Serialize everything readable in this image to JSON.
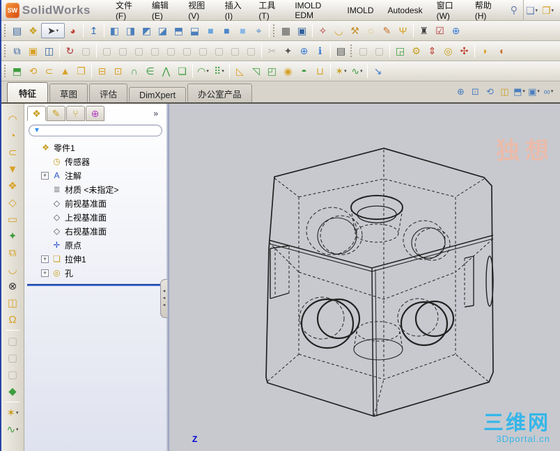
{
  "window": {
    "app_name": "SolidWorks",
    "logo_text": "SW"
  },
  "menu": {
    "items": [
      "文件(F)",
      "编辑(E)",
      "视图(V)",
      "插入(I)",
      "工具(T)",
      "IMOLD EDM",
      "IMOLD",
      "Autodesk",
      "窗口(W)",
      "帮助(H)"
    ],
    "search_glyph": "⚲"
  },
  "quick_access": [
    {
      "n": "new-document-button",
      "g": "❏",
      "c": "#6a82b4",
      "dd": true
    },
    {
      "n": "open-document-button",
      "g": "❐",
      "c": "#d8a228",
      "dd": true
    }
  ],
  "toolbars": {
    "row2": [
      {
        "grip": true
      },
      {
        "n": "properties-icon",
        "g": "▤",
        "c": "#35639f"
      },
      {
        "n": "make-part-icon",
        "g": "❖",
        "c": "#c8a020"
      },
      {
        "n": "select-arrow-icon",
        "g": "➤",
        "c": "#3b3b3b",
        "dd": true,
        "box": true
      },
      {
        "n": "render-sphere-icon",
        "g": "◕",
        "c": "#c04030"
      },
      {
        "sep": true
      },
      {
        "n": "move-entity-icon",
        "g": "↥",
        "c": "#2f6fb4"
      },
      {
        "sep": true
      },
      {
        "n": "view-cube-front-icon",
        "g": "◧",
        "c": "#4a7ebc"
      },
      {
        "n": "view-cube-back-icon",
        "g": "◨",
        "c": "#4a7ebc"
      },
      {
        "n": "view-cube-left-icon",
        "g": "◩",
        "c": "#4a7ebc"
      },
      {
        "n": "view-cube-right-icon",
        "g": "◪",
        "c": "#4a7ebc"
      },
      {
        "n": "view-cube-top-icon",
        "g": "⬒",
        "c": "#4a7ebc"
      },
      {
        "n": "view-cube-bottom-icon",
        "g": "⬓",
        "c": "#4a7ebc"
      },
      {
        "n": "view-iso-icon",
        "g": "■",
        "c": "#6aa5dd"
      },
      {
        "n": "view-trimetric-icon",
        "g": "■",
        "c": "#4a86c8"
      },
      {
        "n": "view-dimetric-icon",
        "g": "■",
        "c": "#86b8e8"
      },
      {
        "n": "flashlight-icon",
        "g": "⌖",
        "c": "#4a86c8"
      },
      {
        "sep": true
      },
      {
        "grip": true
      },
      {
        "n": "print-preview-icon",
        "g": "▦",
        "c": "#555"
      },
      {
        "n": "window-preview-icon",
        "g": "▣",
        "c": "#35639f"
      },
      {
        "sep": true
      },
      {
        "n": "measure-icon",
        "g": "✧",
        "c": "#b03030"
      },
      {
        "n": "mass-properties-icon",
        "g": "◡",
        "c": "#d8a228"
      },
      {
        "n": "check-hammer-icon",
        "g": "⚒",
        "c": "#c8922a"
      },
      {
        "n": "curvature-icon",
        "g": "◌",
        "c": "#d8a228"
      },
      {
        "n": "paint-check-icon",
        "g": "✎",
        "c": "#c8702a"
      },
      {
        "n": "deviation-icon",
        "g": "Ψ",
        "c": "#d8a228"
      },
      {
        "sep": true
      },
      {
        "n": "options-plug-icon",
        "g": "♜",
        "c": "#444"
      },
      {
        "n": "design-checker-icon",
        "g": "☑",
        "c": "#b03030"
      },
      {
        "n": "search-blue-icon",
        "g": "⊕",
        "c": "#3a7bd5"
      }
    ],
    "row3": [
      {
        "grip": true
      },
      {
        "n": "new-from-template-icon",
        "g": "⧉",
        "c": "#35639f"
      },
      {
        "n": "open-recent-icon",
        "g": "▣",
        "c": "#d8a228"
      },
      {
        "n": "save-icon",
        "g": "◫",
        "c": "#35639f"
      },
      {
        "sep": true
      },
      {
        "n": "rotate-view-icon",
        "g": "↻",
        "c": "#b03030"
      },
      {
        "n": "disabled-tool-1",
        "g": "▢",
        "d": true
      },
      {
        "sep": true
      },
      {
        "n": "disabled-tool-2",
        "g": "▢",
        "d": true
      },
      {
        "n": "disabled-tool-3",
        "g": "▢",
        "d": true
      },
      {
        "n": "disabled-tool-4",
        "g": "▢",
        "d": true
      },
      {
        "n": "disabled-tool-5",
        "g": "▢",
        "d": true
      },
      {
        "n": "disabled-tool-6",
        "g": "▢",
        "d": true
      },
      {
        "n": "disabled-tool-7",
        "g": "▢",
        "d": true
      },
      {
        "n": "disabled-tool-8",
        "g": "▢",
        "d": true
      },
      {
        "n": "disabled-tool-9",
        "g": "▢",
        "d": true
      },
      {
        "n": "disabled-tool-10",
        "g": "▢",
        "d": true
      },
      {
        "n": "disabled-tool-11",
        "g": "▢",
        "d": true
      },
      {
        "sep": true
      },
      {
        "n": "disabled-cut-icon",
        "g": "✂",
        "d": true
      },
      {
        "n": "magic-wand-icon",
        "g": "✦",
        "c": "#555"
      },
      {
        "n": "search-round-icon",
        "g": "⊕",
        "c": "#3a7bd5"
      },
      {
        "n": "info-icon",
        "g": "ℹ",
        "c": "#3a7bd5"
      },
      {
        "sep": true
      },
      {
        "n": "report-table-icon",
        "g": "▤",
        "c": "#444"
      },
      {
        "grip": true
      },
      {
        "n": "disabled-view-1",
        "g": "▢",
        "d": true
      },
      {
        "n": "disabled-view-2",
        "g": "▢",
        "d": true
      },
      {
        "sep": true
      },
      {
        "n": "zoom-model-icon",
        "g": "◲",
        "c": "#3f9e3f"
      },
      {
        "n": "gear-icon",
        "g": "⚙",
        "c": "#c8a020"
      },
      {
        "n": "section-arrows-icon",
        "g": "⇕",
        "c": "#c04030"
      },
      {
        "n": "magnify-part-icon",
        "g": "◎",
        "c": "#c8a020"
      },
      {
        "n": "explode-view-icon",
        "g": "✣",
        "c": "#c04030"
      },
      {
        "sep": true
      },
      {
        "n": "appearance-boat-icon",
        "g": "◗",
        "c": "#d8a228"
      },
      {
        "n": "scene-boat-icon",
        "g": "◖",
        "c": "#c8702a"
      }
    ],
    "row4": [
      {
        "grip": true
      },
      {
        "n": "extruded-boss-icon",
        "g": "⬒",
        "c": "#3f9e3f"
      },
      {
        "n": "revolved-boss-icon",
        "g": "⟲",
        "c": "#d8a228"
      },
      {
        "n": "swept-boss-icon",
        "g": "⊂",
        "c": "#d8a228"
      },
      {
        "n": "lofted-boss-icon",
        "g": "▲",
        "c": "#d8a228"
      },
      {
        "n": "boundary-boss-icon",
        "g": "❒",
        "c": "#d8a228"
      },
      {
        "sep": true
      },
      {
        "n": "extruded-cut-icon",
        "g": "⊟",
        "c": "#d8a228"
      },
      {
        "n": "hole-wizard-icon",
        "g": "⊡",
        "c": "#d8a228"
      },
      {
        "n": "revolved-cut-icon",
        "g": "∩",
        "c": "#3f9e3f"
      },
      {
        "n": "swept-cut-icon",
        "g": "∈",
        "c": "#3f9e3f"
      },
      {
        "n": "lofted-cut-icon",
        "g": "⋀",
        "c": "#3f9e3f"
      },
      {
        "n": "boundary-cut-icon",
        "g": "❏",
        "c": "#3f9e3f"
      },
      {
        "sep": true
      },
      {
        "n": "fillet-icon",
        "g": "◠",
        "c": "#3f9e3f",
        "dd": true
      },
      {
        "n": "linear-pattern-icon",
        "g": "⠿",
        "c": "#3f9e3f",
        "dd": true
      },
      {
        "sep": true
      },
      {
        "n": "rib-icon",
        "g": "◺",
        "c": "#d8a228"
      },
      {
        "n": "draft-icon",
        "g": "◹",
        "c": "#3f9e3f"
      },
      {
        "n": "shell-icon",
        "g": "◰",
        "c": "#3f9e3f"
      },
      {
        "n": "wrap-icon",
        "g": "◉",
        "c": "#d8a228"
      },
      {
        "n": "dome-icon",
        "g": "◓",
        "c": "#3f9e3f"
      },
      {
        "n": "mirror-icon",
        "g": "⊔",
        "c": "#d8a228"
      },
      {
        "sep": true
      },
      {
        "n": "reference-geometry-icon",
        "g": "✶",
        "c": "#c8a020",
        "dd": true
      },
      {
        "n": "curves-icon",
        "g": "∿",
        "c": "#3f9e3f",
        "dd": true
      },
      {
        "sep": true
      },
      {
        "n": "instant3d-icon",
        "g": "↘",
        "c": "#3a7bd5"
      }
    ],
    "left": [
      {
        "n": "extruded-surface-icon",
        "g": "◠",
        "c": "#d8a228"
      },
      {
        "n": "revolved-surface-icon",
        "g": "◔",
        "c": "#d8a228"
      },
      {
        "n": "swept-surface-icon",
        "g": "⊂",
        "c": "#d8a228"
      },
      {
        "n": "lofted-surface-icon",
        "g": "▼",
        "c": "#d8a228"
      },
      {
        "n": "boundary-surface-icon",
        "g": "❖",
        "c": "#d8a228"
      },
      {
        "n": "offset-surface-icon",
        "g": "◇",
        "c": "#d8a228"
      },
      {
        "n": "planar-surface-icon",
        "g": "▭",
        "c": "#d8a228"
      },
      {
        "n": "freeform-icon",
        "g": "✦",
        "c": "#3f9e3f"
      },
      {
        "n": "knit-surface-icon",
        "g": "⧉",
        "c": "#d8a228"
      },
      {
        "n": "ruled-surface-icon",
        "g": "◡",
        "c": "#d8a228"
      },
      {
        "n": "delete-face-icon",
        "g": "⊗",
        "c": "#333"
      },
      {
        "n": "replace-face-icon",
        "g": "◫",
        "c": "#d8a228"
      },
      {
        "n": "untrim-surface-icon",
        "g": "Ω",
        "c": "#d8a228"
      },
      {
        "sep": true
      },
      {
        "n": "extend-surface-icon",
        "g": "▢",
        "d": true
      },
      {
        "n": "trim-surface-icon",
        "g": "▢",
        "d": true
      },
      {
        "n": "thicken-icon",
        "g": "▢",
        "d": true
      },
      {
        "n": "fillet-surface-icon",
        "g": "◆",
        "c": "#3f9e3f"
      },
      {
        "sep": true
      },
      {
        "n": "reference-geometry-icon",
        "g": "✶",
        "c": "#c8a020",
        "dd": true
      },
      {
        "n": "curves-icon",
        "g": "∿",
        "c": "#3f9e3f",
        "dd": true
      }
    ],
    "headsup": [
      {
        "n": "zoom-to-fit-icon",
        "g": "⊕",
        "c": "#4a7ebc"
      },
      {
        "n": "zoom-to-area-icon",
        "g": "⊡",
        "c": "#4a7ebc"
      },
      {
        "n": "previous-view-icon",
        "g": "⟲",
        "c": "#4a7ebc"
      },
      {
        "n": "section-view-icon",
        "g": "◫",
        "c": "#c8a020"
      },
      {
        "n": "view-orientation-icon",
        "g": "⬒",
        "c": "#4a7ebc",
        "dd": true
      },
      {
        "n": "display-style-icon",
        "g": "▣",
        "c": "#4a7ebc",
        "dd": true
      },
      {
        "n": "hide-show-items-icon",
        "g": "∞",
        "c": "#4a7ebc",
        "dd": true
      }
    ]
  },
  "command_tabs": {
    "items": [
      {
        "label": "特征",
        "active": true
      },
      {
        "label": "草图",
        "active": false
      },
      {
        "label": "评估",
        "active": false
      },
      {
        "label": "DimXpert",
        "active": false
      },
      {
        "label": "办公室产品",
        "active": false
      }
    ]
  },
  "feature_tree": {
    "tabs": [
      {
        "n": "featuremanager-tab",
        "g": "❖",
        "c": "#c8a020",
        "active": true
      },
      {
        "n": "propertymanager-tab",
        "g": "✎",
        "c": "#c8a020"
      },
      {
        "n": "configurationmanager-tab",
        "g": "⑂",
        "c": "#c8a020"
      },
      {
        "n": "dimxpertmanager-tab",
        "g": "⊕",
        "c": "#b040c0"
      }
    ],
    "chevron": "»",
    "filter_glyph": "▼",
    "items": [
      {
        "root": true,
        "icon": "part-icon",
        "glyph": "❖",
        "color": "#c8a020",
        "label": "零件1"
      },
      {
        "icon": "sensors-folder-icon",
        "glyph": "◷",
        "color": "#c8a020",
        "label": "传感器"
      },
      {
        "icon": "annotations-folder-icon",
        "glyph": "A",
        "color": "#2a52c8",
        "label": "注解",
        "expand": "+"
      },
      {
        "icon": "material-icon",
        "glyph": "≣",
        "color": "#777",
        "label": "材质 <未指定>"
      },
      {
        "icon": "plane-icon",
        "glyph": "◇",
        "color": "#445",
        "label": "前视基准面"
      },
      {
        "icon": "plane-icon",
        "glyph": "◇",
        "color": "#445",
        "label": "上视基准面"
      },
      {
        "icon": "plane-icon",
        "glyph": "◇",
        "color": "#445",
        "label": "右视基准面"
      },
      {
        "icon": "origin-icon",
        "glyph": "✛",
        "color": "#2a52c8",
        "label": "原点"
      },
      {
        "icon": "extrude-feature-icon",
        "glyph": "❏",
        "color": "#c8a020",
        "label": "拉伸1",
        "expand": "+"
      },
      {
        "icon": "hole-feature-icon",
        "glyph": "◎",
        "color": "#c8a020",
        "label": "孔",
        "expand": "+"
      }
    ]
  },
  "viewport": {
    "triad_z_label": "Z",
    "watermark_top": "独想",
    "watermark_brand": "三维网",
    "watermark_domain": "3Dportal.cn"
  },
  "colors": {
    "viewport_bg": "#c7c9cf",
    "rollback_blue": "#3a6bd6",
    "watermark_pink": "#f0b9a5",
    "watermark_blue": "#35b6e9"
  }
}
